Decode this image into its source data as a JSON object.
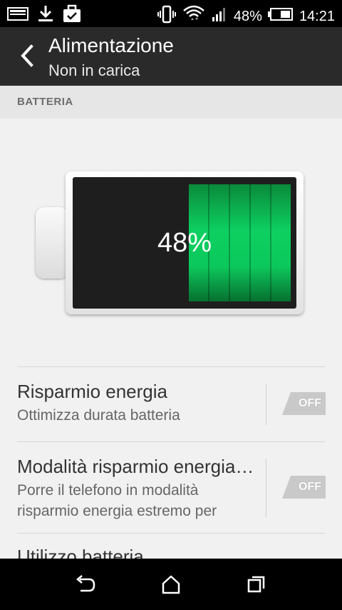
{
  "status_bar": {
    "battery_percent": "48%",
    "time": "14:21",
    "left_icons": [
      "sd-card-icon",
      "download-icon",
      "briefcase-check-icon"
    ],
    "right_icons": [
      "vibrate-icon",
      "wifi-icon",
      "signal-icon",
      "battery-icon"
    ]
  },
  "header": {
    "title": "Alimentazione",
    "subtitle": "Non in carica"
  },
  "section": {
    "label": "BATTERIA"
  },
  "battery_graphic": {
    "level_text": "48%",
    "level_fraction": 0.48
  },
  "settings": [
    {
      "title": "Risparmio energia",
      "subtitle": "Ottimizza durata batteria",
      "toggle": "OFF"
    },
    {
      "title": "Modalità risparmio energia e…",
      "subtitle": "Porre il telefono in modalità risparmio energia estremo per",
      "toggle": "OFF"
    },
    {
      "title": "Utilizzo batteria"
    }
  ],
  "colors": {
    "accent_green": "#0dd061",
    "header_bg": "#2a2a2a"
  }
}
